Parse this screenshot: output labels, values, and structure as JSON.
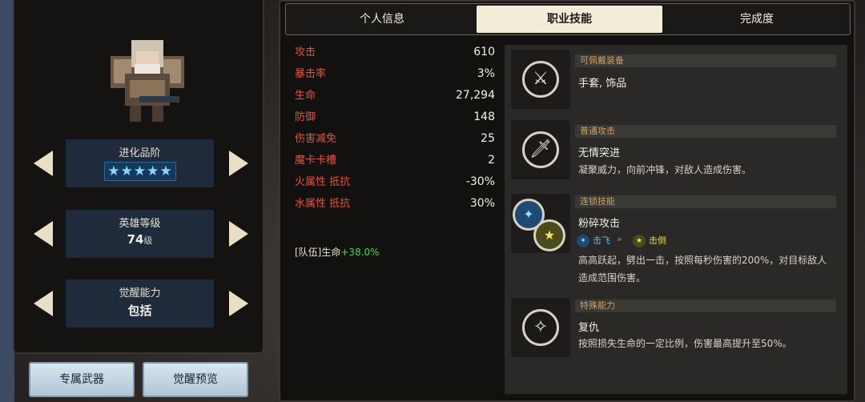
{
  "left": {
    "hero_sprite": "armored-warrior-sprite",
    "rows": [
      {
        "label": "进化品阶",
        "value": "★★★★★"
      },
      {
        "label": "英雄等级",
        "value": "74",
        "unit": "级"
      },
      {
        "label": "觉醒能力",
        "value": "包括"
      }
    ],
    "buttons": [
      "专属武器",
      "觉醒预览"
    ]
  },
  "tabs": [
    "个人信息",
    "职业技能",
    "完成度"
  ],
  "active_tab": 1,
  "stats": [
    {
      "name": "攻击",
      "value": "610"
    },
    {
      "name": "暴击率",
      "value": "3%"
    },
    {
      "name": "生命",
      "value": "27,294"
    },
    {
      "name": "防御",
      "value": "148"
    },
    {
      "name": "伤害减免",
      "value": "25"
    },
    {
      "name": "魔卡卡槽",
      "value": "2"
    },
    {
      "name": "火属性 抵抗",
      "value": "-30%"
    },
    {
      "name": "水属性 抵抗",
      "value": "30%"
    }
  ],
  "team_bonus": {
    "label": "[队伍]生命",
    "value": "+38.0%"
  },
  "skills": {
    "equip": {
      "category": "可佩戴装备",
      "name": "手套, 饰品",
      "icon": "sword-shield-icon"
    },
    "normal": {
      "category": "普通攻击",
      "name": "无情突进",
      "desc": "凝聚威力，向前冲锋，对敌人造成伤害。",
      "icon": "sword-icon"
    },
    "chain": {
      "category": "连锁技能",
      "name": "粉碎攻击",
      "tag1": "击飞",
      "chevrons": "»",
      "tag2": "击倒",
      "desc": "高高跃起，劈出一击，按照每秒伤害的200%，对目标敌人造成范围伤害。",
      "icon": "chain-icon"
    },
    "special": {
      "category": "特殊能力",
      "name": "复仇",
      "desc": "按照损失生命的一定比例，伤害最高提升至50%。",
      "icon": "sparkle-icon"
    }
  },
  "colors": {
    "stat_name": "#e0553e",
    "bonus": "#4fd34a",
    "category": "#c9a36a",
    "tag_blue": "#4fc3f7",
    "tag_yellow": "#e8d64a"
  }
}
